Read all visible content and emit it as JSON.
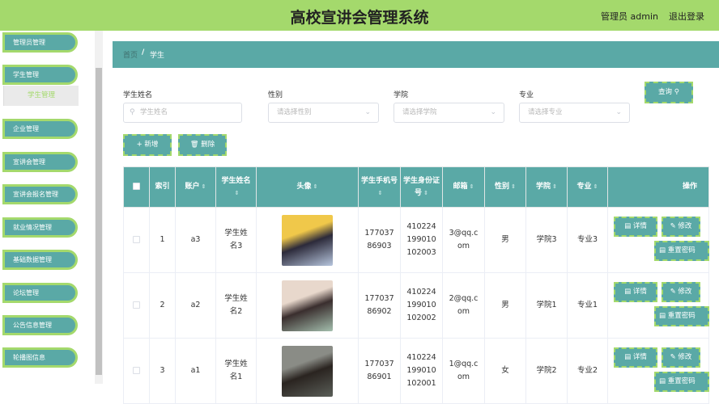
{
  "header": {
    "title": "高校宣讲会管理系统",
    "admin": "管理员 admin",
    "logout": "退出登录"
  },
  "sidebar": {
    "items": [
      {
        "label": "管理员管理"
      },
      {
        "label": "学生管理"
      },
      {
        "label": "企业管理"
      },
      {
        "label": "宣讲会管理"
      },
      {
        "label": "宣讲会报名管理"
      },
      {
        "label": "就业情况管理"
      },
      {
        "label": "基础数据管理"
      },
      {
        "label": "论坛管理"
      },
      {
        "label": "公告信息管理"
      },
      {
        "label": "轮播图信息"
      }
    ],
    "submenu": "学生管理"
  },
  "breadcrumb": {
    "home": "首页",
    "separator": "/",
    "current": "学生"
  },
  "filters": {
    "name_label": "学生姓名",
    "name_placeholder": "学生姓名",
    "gender_label": "性别",
    "gender_placeholder": "请选择性别",
    "college_label": "学院",
    "college_placeholder": "请选择学院",
    "major_label": "专业",
    "major_placeholder": "请选择专业",
    "search": "查询"
  },
  "actions": {
    "add": "新增",
    "delete": "删除"
  },
  "table": {
    "headers": {
      "index": "索引",
      "account": "账户",
      "name": "学生姓名",
      "avatar": "头像",
      "phone": "学生手机号",
      "idcard": "学生身份证号",
      "email": "邮箱",
      "gender": "性别",
      "college": "学院",
      "major": "专业",
      "ops": "操作"
    },
    "rows": [
      {
        "index": "1",
        "account": "a3",
        "name": "学生姓名3",
        "phone": "17703786903",
        "idcard": "410224199010102003",
        "email": "3@qq.com",
        "gender": "男",
        "college": "学院3",
        "major": "专业3",
        "avatar_colors": [
          "#f0c84a",
          "#2c2a3a",
          "#b7c6de"
        ]
      },
      {
        "index": "2",
        "account": "a2",
        "name": "学生姓名2",
        "phone": "17703786902",
        "idcard": "410224199010102002",
        "email": "2@qq.com",
        "gender": "男",
        "college": "学院1",
        "major": "专业1",
        "avatar_colors": [
          "#e8d8cc",
          "#3a2e2e",
          "#a4bfae"
        ]
      },
      {
        "index": "3",
        "account": "a1",
        "name": "学生姓名1",
        "phone": "17703786901",
        "idcard": "410224199010102001",
        "email": "1@qq.com",
        "gender": "女",
        "college": "学院2",
        "major": "专业2",
        "avatar_colors": [
          "#8a8c86",
          "#2a2420",
          "#5a5e58"
        ]
      }
    ],
    "buttons": {
      "detail": "详情",
      "edit": "修改",
      "reset": "重置密码"
    }
  },
  "colors": {
    "accent": "#a4d96c",
    "primary": "#5aa9a6"
  }
}
